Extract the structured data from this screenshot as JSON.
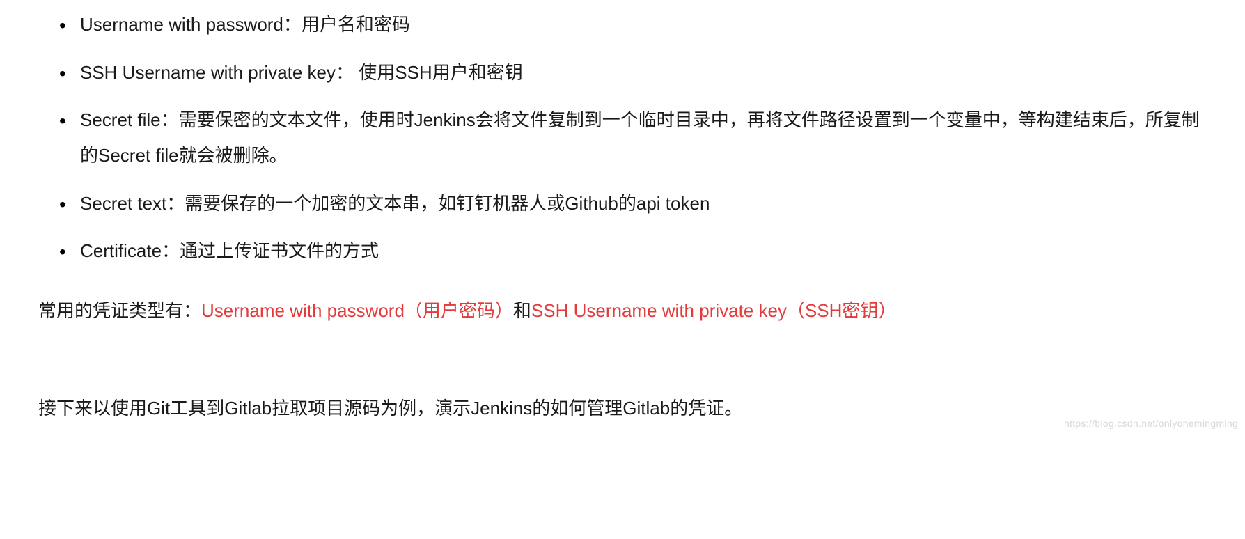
{
  "list": {
    "item1": "Username with password：用户名和密码",
    "item2": "SSH Username with private key： 使用SSH用户和密钥",
    "item3": "Secret file：需要保密的文本文件，使用时Jenkins会将文件复制到一个临时目录中，再将文件路径设置到一个变量中，等构建结束后，所复制的Secret file就会被删除。",
    "item4": "Secret text：需要保存的一个加密的文本串，如钉钉机器人或Github的api token",
    "item5": "Certificate：通过上传证书文件的方式"
  },
  "summary": {
    "prefix": "常用的凭证类型有：",
    "highlight1": "Username with password（用户密码）",
    "mid": "和",
    "highlight2": "SSH Username with private key（SSH密钥）"
  },
  "nextStep": "接下来以使用Git工具到Gitlab拉取项目源码为例，演示Jenkins的如何管理Gitlab的凭证。",
  "watermark": "https://blog.csdn.net/onlyonemingming"
}
